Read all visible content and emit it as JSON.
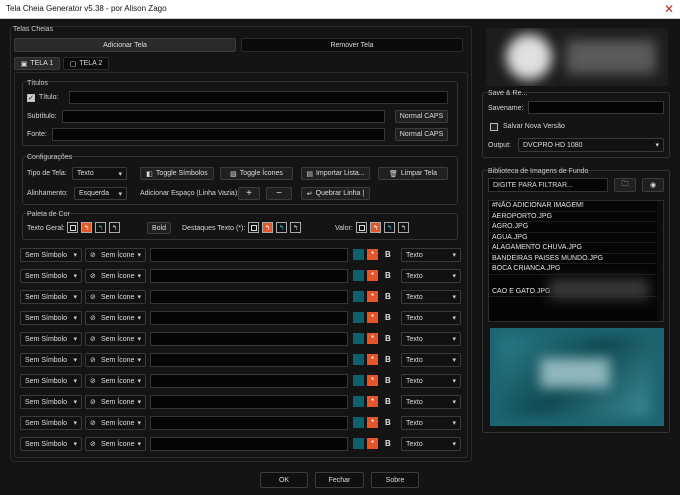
{
  "window": {
    "title": "Tela Cheia Generator v5.38 - por Alison Zago"
  },
  "telas_cheias": {
    "label": "Telas Cheias",
    "add_button": "Adicionar Tela",
    "remove_button": "Remover Tela",
    "tabs": [
      {
        "label": "TELA 1"
      },
      {
        "label": "TELA 2"
      }
    ]
  },
  "titulos": {
    "label": "Títulos",
    "titulo_label": "Título:",
    "subtitulo_label": "Subtítulo:",
    "fonte_label": "Fonte:",
    "titulo_value": "",
    "subtitulo_value": "",
    "fonte_value": "",
    "normal_caps_1": "Normal CAPS",
    "normal_caps_2": "Normal CAPS"
  },
  "config": {
    "label": "Configurações",
    "tipo_label": "Tipo de Tela:",
    "tipo_value": "Texto",
    "toggle_simbolos": "Toggle Símbolos",
    "toggle_icones": "Toggle Ícones",
    "importar_lista": "Importar Lista...",
    "limpar_tela": "Limpar Tela",
    "alinhamento_label": "Alinhamento:",
    "alinhamento_value": "Esquerda",
    "adicionar_espaco": "Adicionar Espaço (Linha Vazia):",
    "plus": "+",
    "minus": "−",
    "quebrar_linha": "Quebrar Linha |"
  },
  "paleta": {
    "label": "Paleta de Cor",
    "texto_geral": "Texto Geral:",
    "bold": "Bold",
    "destaques": "Destaques Texto (*):",
    "valor": "Valor:",
    "colors": {
      "orange": "#e5552a",
      "teal": "#0e5f6c"
    }
  },
  "rows": {
    "simbolo": "Sem Símbolo",
    "icone": "Sem Ícone",
    "star": "*",
    "bold": "B",
    "tipo": "Texto"
  },
  "footer": {
    "ok": "OK",
    "fechar": "Fechar",
    "sobre": "Sobre"
  },
  "right": {
    "save_label": "Save & Re...",
    "savename_label": "Savename:",
    "salvar_nova_versao": "Salvar Nova Versão",
    "output_label": "Output:",
    "output_value": "DVCPRO HD 1080",
    "biblioteca_label": "Biblioteca de Imagens de Fundo",
    "filter_placeholder": "DIGITE PARA FILTRAR...",
    "images": [
      "#NÃO ADICIONAR IMAGEM!",
      "AEROPORTO.JPG",
      "AGRO.JPG",
      "AGUA.JPG",
      "ALAGAMENTO CHUVA.JPG",
      "BANDEIRAS PAISES MUNDO.JPG",
      "BOCA CRIANCA.JPG",
      "CAO E GATO.JPG"
    ]
  }
}
